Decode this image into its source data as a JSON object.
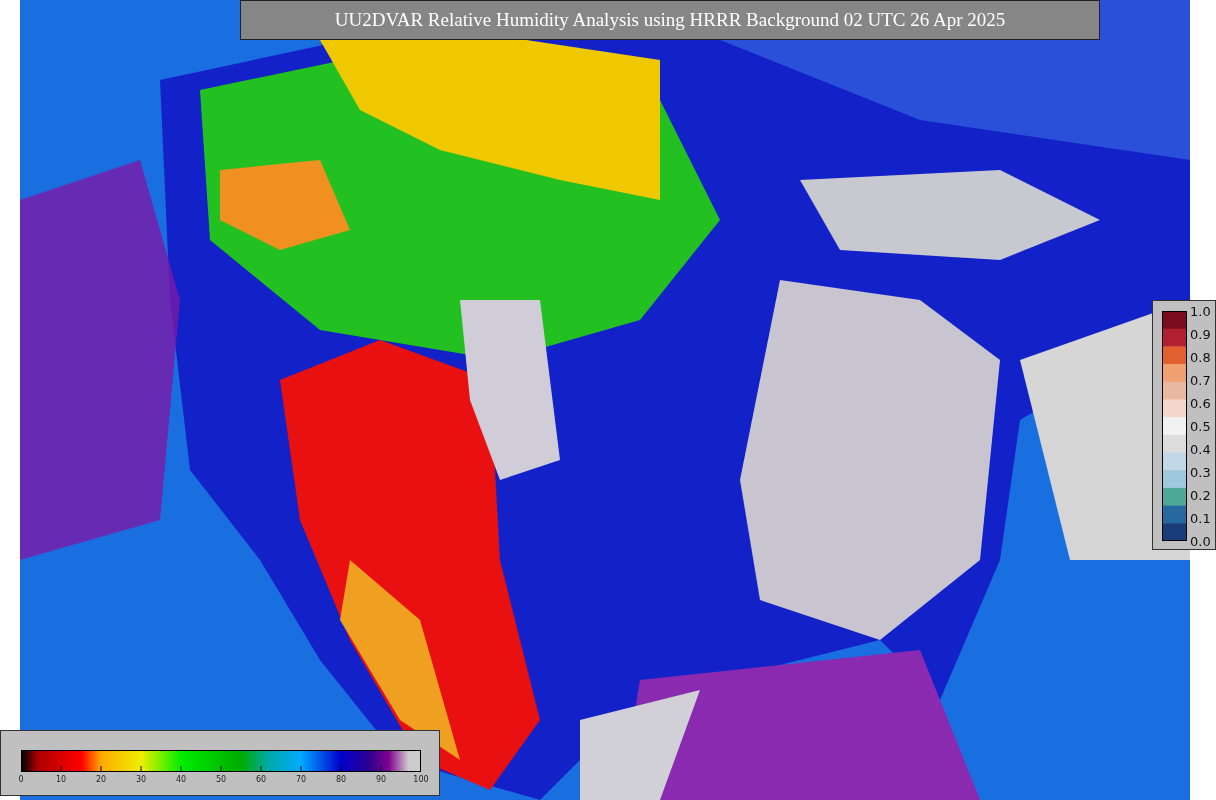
{
  "title": "UU2DVAR Relative Humidity Analysis using HRRR Background 02 UTC 26 Apr 2025",
  "humidity_scale": {
    "ticks": [
      "0",
      "10",
      "20",
      "30",
      "40",
      "50",
      "60",
      "70",
      "80",
      "90",
      "100"
    ]
  },
  "ratio_scale": {
    "ticks": [
      "1.0",
      "0.9",
      "0.8",
      "0.7",
      "0.6",
      "0.5",
      "0.4",
      "0.3",
      "0.2",
      "0.1",
      "0.0"
    ]
  }
}
